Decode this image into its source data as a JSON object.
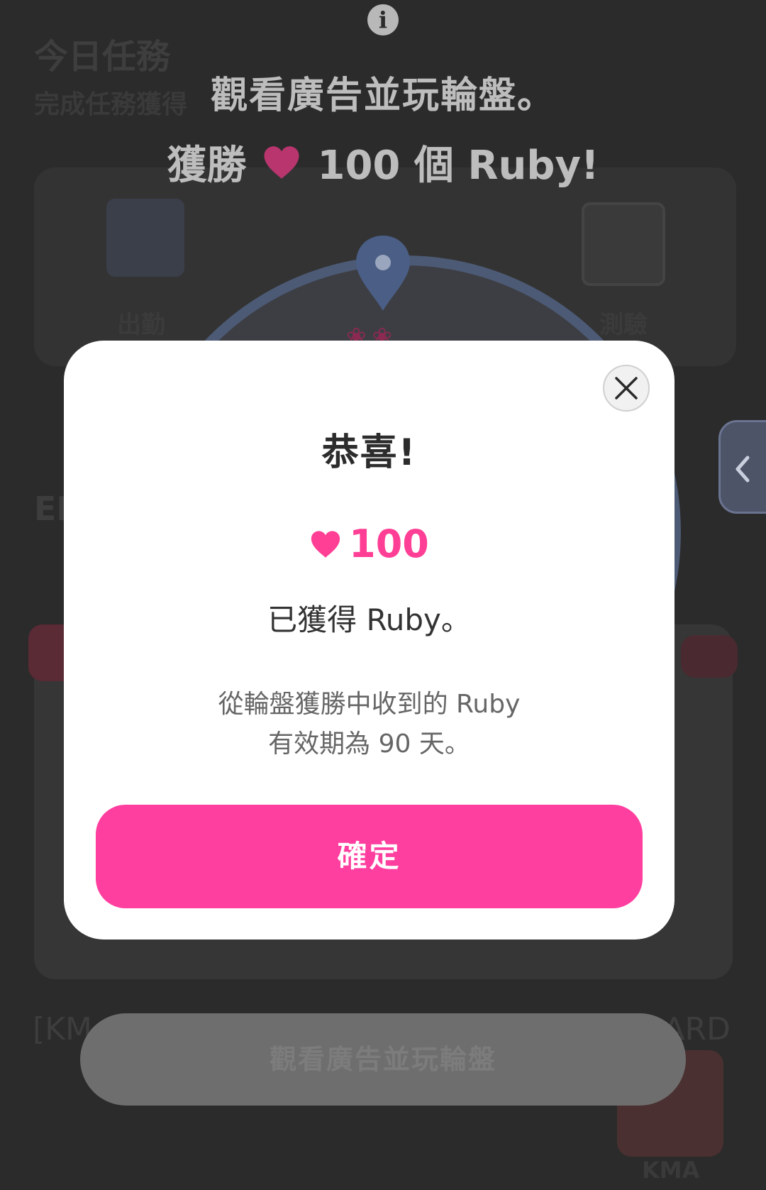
{
  "background": {
    "section_title": "今日任務",
    "section_subtitle": "完成任務獲得",
    "card_left_label": "出勤",
    "card_right_label": "測驗",
    "heading2": "EI",
    "list_title_left": "[KM",
    "list_title_right": "ARD",
    "thumb_label": "KMA"
  },
  "promo": {
    "line1": "觀看廣告並玩輪盤。",
    "line2_prefix": "獲勝",
    "line2_suffix": "100 個 Ruby!"
  },
  "bottom_button": {
    "label": "觀看廣告並玩輪盤"
  },
  "modal": {
    "title": "恭喜!",
    "reward_amount": "100",
    "obtained": "已獲得 Ruby。",
    "note_line1": "從輪盤獲勝中收到的 Ruby",
    "note_line2": "有效期為 90 天。",
    "confirm_label": "確定"
  },
  "icons": {
    "info": "info-icon",
    "close": "close-icon",
    "heart": "heart-icon",
    "side_tab": "chevron-left-icon"
  },
  "colors": {
    "accent_pink": "#ff3f9f",
    "ruby_pink": "#ff3f95",
    "overlay": "#2b2b2b"
  }
}
